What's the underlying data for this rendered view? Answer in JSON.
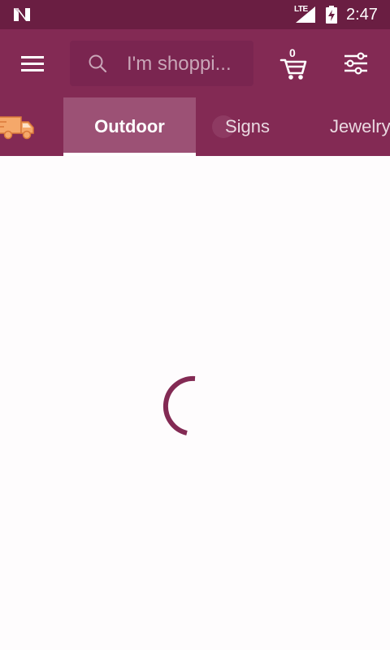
{
  "status_bar": {
    "network_type": "LTE",
    "time": "2:47",
    "icons": [
      "android-n-icon",
      "signal-icon",
      "battery-charging-icon"
    ]
  },
  "toolbar": {
    "menu_icon": "hamburger-menu-icon",
    "search": {
      "placeholder": "I'm shoppi...",
      "icon": "search-icon"
    },
    "cart": {
      "icon": "shopping-cart-icon",
      "count": "0"
    },
    "filter_icon": "sliders-filter-icon"
  },
  "tabs": {
    "leading_icon": "delivery-truck-icon",
    "items": [
      {
        "label": "Outdoor",
        "active": true
      },
      {
        "label": "Signs",
        "active": false
      },
      {
        "label": "Jewelry",
        "active": false
      }
    ]
  },
  "content": {
    "loading_indicator": "loading-spinner-icon"
  },
  "colors": {
    "status_bar": "#6a1e42",
    "primary": "#832a54",
    "active_tab": "#9c5175",
    "spinner": "#832a54",
    "truck": "#f5a86a"
  }
}
